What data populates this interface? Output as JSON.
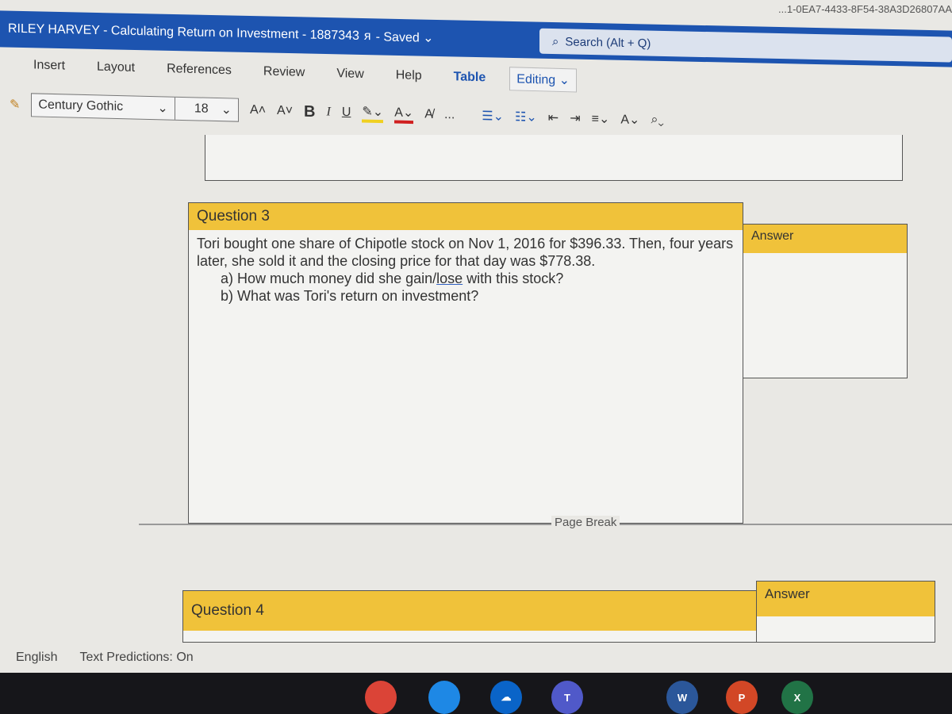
{
  "url_fragment": "...1-0EA7-4433-8F54-38A3D26807AA",
  "titlebar": {
    "title": "RILEY HARVEY - Calculating Return on Investment - 1887343",
    "share_icon": "people-icon",
    "saved": "- Saved ⌄",
    "search": "Search (Alt + Q)"
  },
  "tabs": [
    "Insert",
    "Layout",
    "References",
    "Review",
    "View",
    "Help",
    "Table"
  ],
  "editing": "Editing ⌄",
  "toolbar": {
    "font": "Century Gothic",
    "font_size": "18",
    "grow": "A˄",
    "shrink": "A˅",
    "bold": "B",
    "italic": "I",
    "underline": "U",
    "highlight": "✎⌄",
    "font_color": "A⌄",
    "clear": "A̸",
    "more": "...",
    "bullets": "☰⌄",
    "numbering": "☷⌄",
    "outdent": "⇤",
    "indent": "⇥",
    "align": "≡⌄",
    "styles": "A⌄",
    "find": "⌕⌄"
  },
  "q3": {
    "heading": "Question 3",
    "answer_label": "Answer",
    "text": "Tori bought one share of Chipotle stock on Nov 1, 2016 for $396.33. Then, four years later, she sold it and the closing price for that day was $778.38.",
    "a_pre": "a) How much money did she gain/",
    "a_ul": "lose",
    "a_post": " with this stock?",
    "b": "b) What was Tori's return on investment?"
  },
  "page_break": "Page Break",
  "q4": {
    "heading": "Question 4",
    "answer_label": "Answer"
  },
  "status": {
    "language": "English",
    "predictions": "Text Predictions: On"
  },
  "taskbar": [
    {
      "name": "chrome-icon",
      "label": "",
      "color": "#db4437"
    },
    {
      "name": "files-icon",
      "label": "",
      "color": "#1e88e5"
    },
    {
      "name": "onedrive-icon",
      "label": "☁",
      "color": "#0a64c8"
    },
    {
      "name": "teams-icon",
      "label": "T",
      "color": "#5059c9"
    },
    {
      "name": "word-icon",
      "label": "W",
      "color": "#2b579a"
    },
    {
      "name": "powerpoint-icon",
      "label": "P",
      "color": "#d24726"
    },
    {
      "name": "excel-icon",
      "label": "X",
      "color": "#217346"
    }
  ]
}
